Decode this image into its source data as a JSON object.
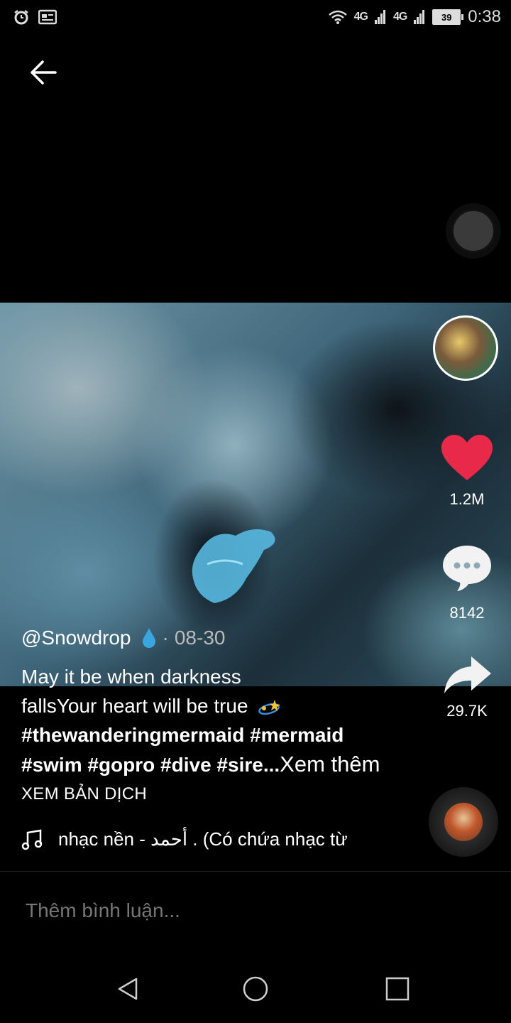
{
  "status_bar": {
    "time": "0:38",
    "battery": "39",
    "signal_1": "4G",
    "signal_2": "4G"
  },
  "post": {
    "author": "@Snowdrop",
    "date": "08-30",
    "caption_line1": "May it be when darkness",
    "caption_line2": "fallsYour heart will be true",
    "tags_line1": "#thewanderingmermaid #mermaid",
    "tags_line2": "#swim #gopro #dive #sire...",
    "see_more": "Xem thêm",
    "translate": "XEM BẢN DỊCH",
    "music": "nhạc nền - أحمد . (Có chứa nhạc từ"
  },
  "stats": {
    "likes": "1.2M",
    "comments": "8142",
    "shares": "29.7K"
  },
  "comment_box": {
    "placeholder": "Thêm bình luận..."
  },
  "colors": {
    "like": "#e8294a",
    "background": "#000000"
  },
  "icons": {
    "back": "back-arrow-icon",
    "like": "heart-icon",
    "comment": "comment-bubble-icon",
    "share": "share-arrow-icon",
    "music": "music-note-icon"
  }
}
